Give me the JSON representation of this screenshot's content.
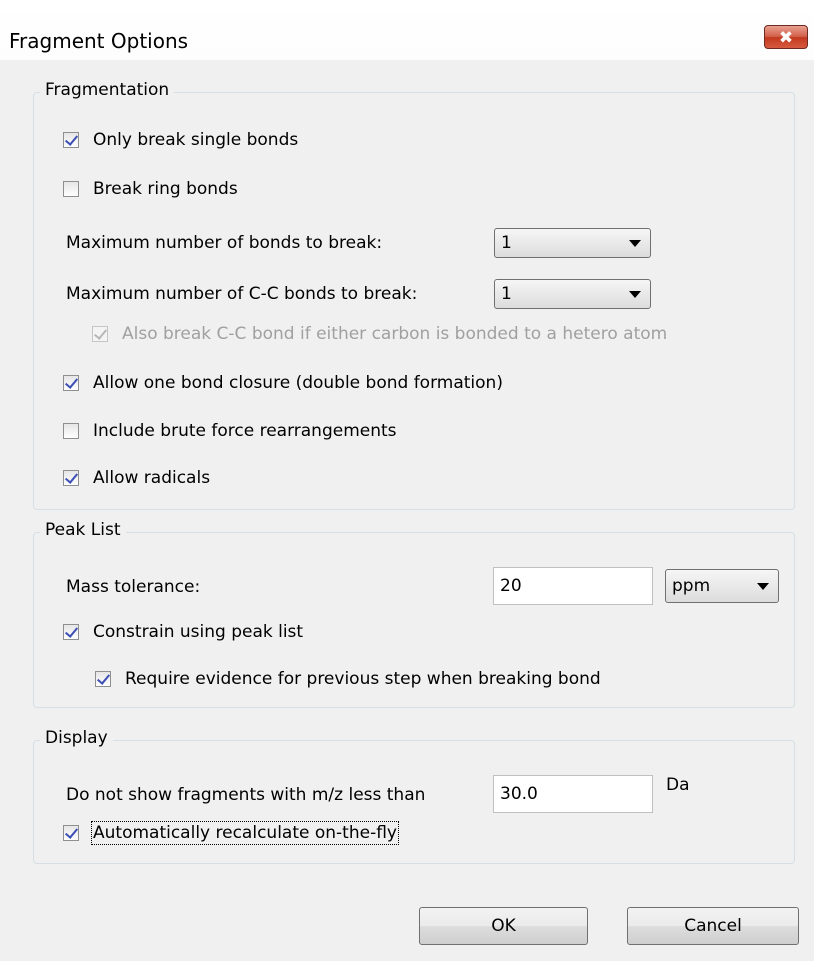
{
  "window": {
    "title": "Fragment Options",
    "close_glyph": "✖"
  },
  "fragmentation": {
    "legend": "Fragmentation",
    "only_break_single_bonds": {
      "label": "Only break single bonds",
      "checked": true
    },
    "break_ring_bonds": {
      "label": "Break ring bonds",
      "checked": false
    },
    "max_bonds": {
      "label": "Maximum number of bonds to break:",
      "value": "1"
    },
    "max_cc_bonds": {
      "label": "Maximum number of C-C bonds to break:",
      "value": "1"
    },
    "hetero_atom": {
      "label": "Also break C-C bond if either carbon is bonded to a hetero atom",
      "checked": true,
      "enabled": false
    },
    "bond_closure": {
      "label": "Allow one bond closure (double bond formation)",
      "checked": true
    },
    "brute_force": {
      "label": "Include brute force rearrangements",
      "checked": false
    },
    "radicals": {
      "label": "Allow radicals",
      "checked": true
    }
  },
  "peak_list": {
    "legend": "Peak List",
    "mass_tolerance": {
      "label": "Mass tolerance:",
      "value": "20",
      "unit": "ppm"
    },
    "constrain": {
      "label": "Constrain using peak list",
      "checked": true
    },
    "require_evidence": {
      "label": "Require evidence for previous step when breaking bond",
      "checked": true
    }
  },
  "display": {
    "legend": "Display",
    "min_mz": {
      "label": "Do not show fragments with m/z less than",
      "value": "30.0",
      "unit": "Da"
    },
    "auto_recalc": {
      "label": "Automatically recalculate on-the-fly",
      "checked": true
    }
  },
  "buttons": {
    "ok": "OK",
    "cancel": "Cancel"
  }
}
